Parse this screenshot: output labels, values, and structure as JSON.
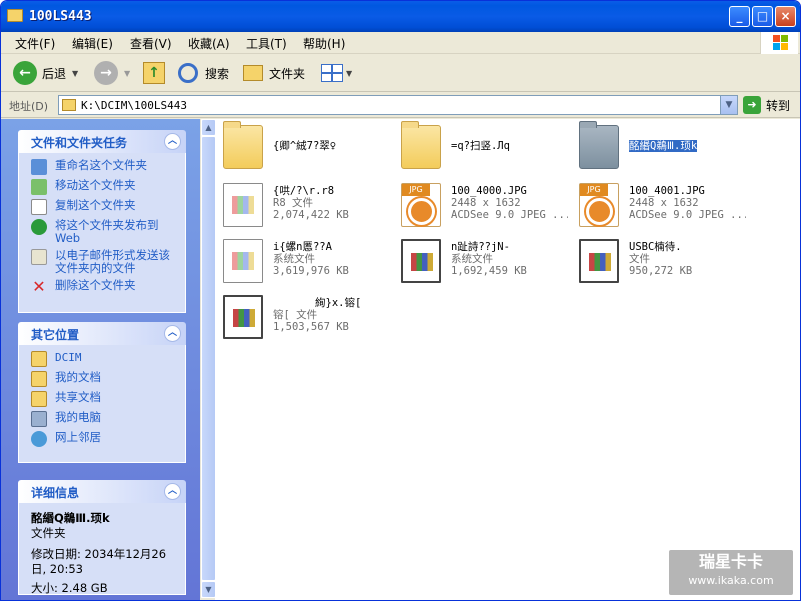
{
  "window": {
    "title": "100LS443"
  },
  "title_buttons": {
    "minimize": "_",
    "maximize": "□",
    "close": "×"
  },
  "menu": {
    "items": [
      "文件(F)",
      "编辑(E)",
      "查看(V)",
      "收藏(A)",
      "工具(T)",
      "帮助(H)"
    ]
  },
  "toolbar": {
    "back": "后退",
    "search": "搜索",
    "folders": "文件夹"
  },
  "address": {
    "label": "地址(D)",
    "value": "K:\\DCIM\\100LS443",
    "go": "转到"
  },
  "panels": {
    "tasks": {
      "title": "文件和文件夹任务",
      "items": [
        "重命名这个文件夹",
        "移动这个文件夹",
        "复制这个文件夹",
        "将这个文件夹发布到 Web",
        "以电子邮件形式发送该文件夹内的文件",
        "删除这个文件夹"
      ]
    },
    "places": {
      "title": "其它位置",
      "items": [
        "DCIM",
        "我的文档",
        "共享文档",
        "我的电脑",
        "网上邻居"
      ]
    },
    "details": {
      "title": "详细信息",
      "name": "酩緡Q鵜Ⅲ.顼k",
      "type": "文件夹",
      "modified_label": "修改日期:",
      "modified": "2034年12月26日, 20:53",
      "size_label": "大小:",
      "size": "2.48 GB"
    }
  },
  "files": [
    {
      "name": "{卿^絨7?翠♀",
      "line2": "",
      "line3": "",
      "kind": "folder"
    },
    {
      "name": "=q?扫竖.Лq",
      "line2": "",
      "line3": "",
      "kind": "folder"
    },
    {
      "name": "酩緡Q鵜Ⅲ.顼k",
      "line2": "",
      "line3": "",
      "kind": "folder-gray"
    },
    {
      "name": "{哄/?\\r.r8",
      "line2": "R8 文件",
      "line3": "2,074,422 KB",
      "kind": "sys"
    },
    {
      "name": "100_4000.JPG",
      "line2": "2448 x 1632",
      "line3": "ACDSee 9.0 JPEG ...",
      "kind": "jpg"
    },
    {
      "name": "100_4001.JPG",
      "line2": "2448 x 1632",
      "line3": "ACDSee 9.0 JPEG ...",
      "kind": "jpg"
    },
    {
      "name": "i{螺n慝??A",
      "line2": "系统文件",
      "line3": "3,619,976 KB",
      "kind": "sys"
    },
    {
      "name": "n趾詩??jN-",
      "line2": "系统文件",
      "line3": "1,692,459 KB",
      "kind": "sys-dark"
    },
    {
      "name": "USBC楠待.",
      "line2": "文件",
      "line3": "950,272 KB",
      "kind": "sys-dark"
    },
    {
      "name": "　　　　絢}x.镕[",
      "line2": "镕[ 文件",
      "line3": "1,503,567 KB",
      "kind": "sys-dark"
    }
  ],
  "watermark": {
    "line1": "瑞星卡卡",
    "line2": "www.ikaka.com"
  },
  "colors": {
    "title_blue": "#0058e0",
    "task_link": "#215dc6",
    "pane_bg": "#7ba2e7",
    "selection": "#316ac5"
  }
}
